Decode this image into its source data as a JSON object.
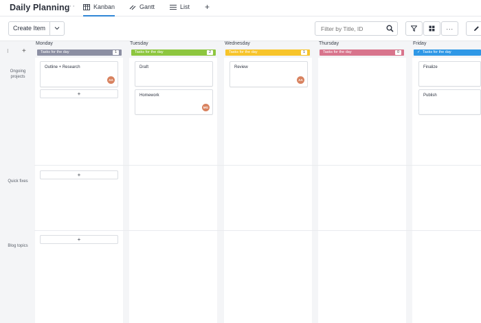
{
  "header": {
    "title": "Daily Planning",
    "more": "···",
    "tabs": [
      {
        "label": "Kanban",
        "icon": "kanban-icon",
        "active": true
      },
      {
        "label": "Gantt",
        "icon": "gantt-icon",
        "active": false
      },
      {
        "label": "List",
        "icon": "list-icon",
        "active": false
      }
    ],
    "add_tab": "+"
  },
  "toolbar": {
    "create_label": "Create Item",
    "create_caret": "⌄",
    "filter_placeholder": "Filter by Title, ID",
    "more_label": "···"
  },
  "board": {
    "left_controls": {
      "collapse": "⁝",
      "add": "+"
    },
    "bar_label": "Tasks for the day",
    "days": [
      {
        "name": "Monday",
        "count": "1",
        "color": "#8c8fa3"
      },
      {
        "name": "Tuesday",
        "count": "2",
        "color": "#8dc63f"
      },
      {
        "name": "Wednesday",
        "count": "1",
        "color": "#f7c42a"
      },
      {
        "name": "Thursday",
        "count": "0",
        "color": "#d8748c"
      },
      {
        "name": "Friday",
        "count": "",
        "color": "#2f98e6",
        "check": "✓"
      }
    ],
    "swimlanes": [
      {
        "label": "Ongoing projects"
      },
      {
        "label": "Quick fixes"
      },
      {
        "label": "Blog topics"
      }
    ],
    "cards": {
      "monday_ongoing": [
        {
          "title": "Outline + Research",
          "avatar": "AA"
        }
      ],
      "tuesday_ongoing": [
        {
          "title": "Draft",
          "avatar": ""
        },
        {
          "title": "Homework",
          "avatar": "MG"
        }
      ],
      "wednesday_ongoing": [
        {
          "title": "Review",
          "avatar": "AA"
        }
      ],
      "friday_ongoing": [
        {
          "title": "Finalize",
          "avatar": ""
        },
        {
          "title": "Publish",
          "avatar": ""
        }
      ]
    },
    "add_label": "+"
  },
  "colors": {
    "accent": "#2f86d6",
    "avatar": "#d8825f"
  }
}
